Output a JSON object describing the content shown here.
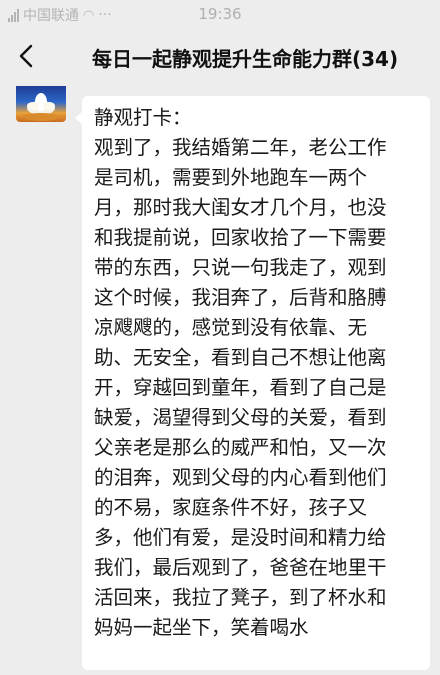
{
  "status_bar": {
    "carrier": "中国联通",
    "dots": "···",
    "time": "19:36"
  },
  "nav": {
    "title": "每日一起静观提升生命能力群(34)"
  },
  "message": {
    "lines": [
      "静观打卡：",
      "观到了，我结婚第二年，老公工作",
      "是司机，需要到外地跑车一两个",
      "月，那时我大闺女才几个月，也没",
      "和我提前说，回家收拾了一下需要",
      "带的东西，只说一句我走了，观到",
      "这个时候，我泪奔了，后背和胳膊",
      "凉飕飕的，感觉到没有依靠、无",
      "助、无安全，看到自己不想让他离",
      "开，穿越回到童年，看到了自己是",
      "缺爱，渴望得到父母的关爱，看到",
      "父亲老是那么的威严和怕，又一次",
      "的泪奔，观到父母的内心看到他们",
      "的不易，家庭条件不好，孩子又",
      "多，他们有爱，是没时间和精力给",
      "我们，最后观到了，爸爸在地里干",
      "活回来，我拉了凳子，到了杯水和",
      "妈妈一起坐下，笑着喝水"
    ]
  },
  "colors": {
    "background": "#ededed",
    "bubble": "#ffffff",
    "text": "#1a1a1a"
  }
}
